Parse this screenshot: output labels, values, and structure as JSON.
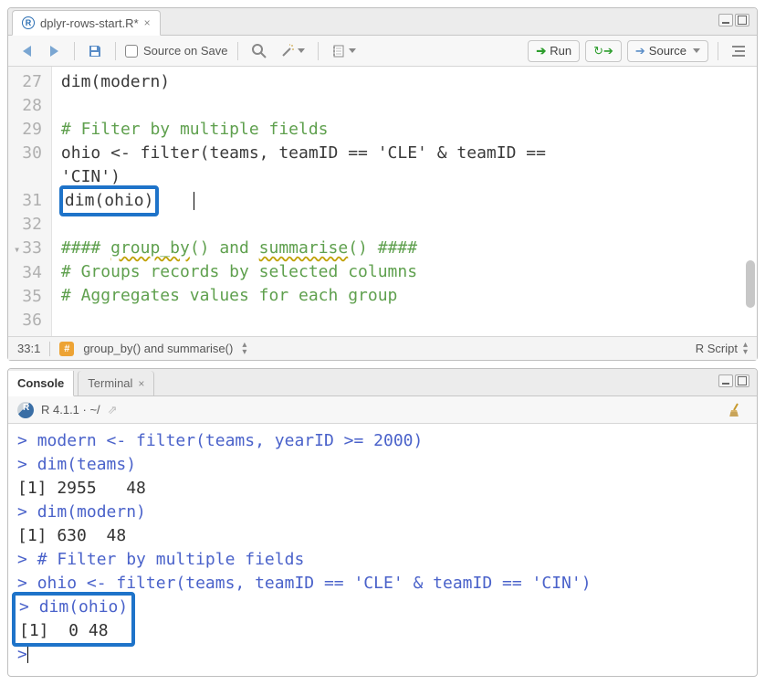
{
  "editor": {
    "tab_label": "dplyr-rows-start.R*",
    "source_on_save": "Source on Save",
    "run_label": "Run",
    "source_label": "Source",
    "lines": {
      "27": {
        "n": "27",
        "code": "dim(modern)"
      },
      "28": {
        "n": "28",
        "code": ""
      },
      "29": {
        "n": "29",
        "comment": "# Filter by multiple fields"
      },
      "30": {
        "n": "30",
        "a": "ohio <- filter(teams, teamID == ",
        "s1": "'CLE'",
        "b": " & teamID == ",
        "cont": "'CIN'",
        "close": ")"
      },
      "31": {
        "n": "31",
        "hl": "dim(ohio)"
      },
      "32": {
        "n": "32",
        "code": ""
      },
      "33": {
        "n": "33",
        "a": "#### ",
        "f1": "group_by",
        "b": "() and ",
        "f2": "summarise",
        "c": "() ####"
      },
      "34": {
        "n": "34",
        "comment": "# Groups records by selected columns"
      },
      "35": {
        "n": "35",
        "comment": "# Aggregates values for each group"
      },
      "36": {
        "n": "36",
        "code": ""
      }
    },
    "status_pos": "33:1",
    "status_scope": "group_by() and summarise()",
    "status_lang": "R Script"
  },
  "console": {
    "tabs": {
      "console": "Console",
      "terminal": "Terminal"
    },
    "r_version": "R 4.1.1 · ~/",
    "lines": {
      "l1": "modern <- filter(teams, yearID >= 2000)",
      "l2": "dim(teams)",
      "o2": "[1] 2955   48",
      "l3": "dim(modern)",
      "o3": "[1] 630  48",
      "l4": "# Filter by multiple fields",
      "l5": "ohio <- filter(teams, teamID == 'CLE' & teamID == 'CIN')",
      "l6": "dim(ohio)",
      "o6": "[1]  0 48",
      "prompt": ">"
    }
  }
}
